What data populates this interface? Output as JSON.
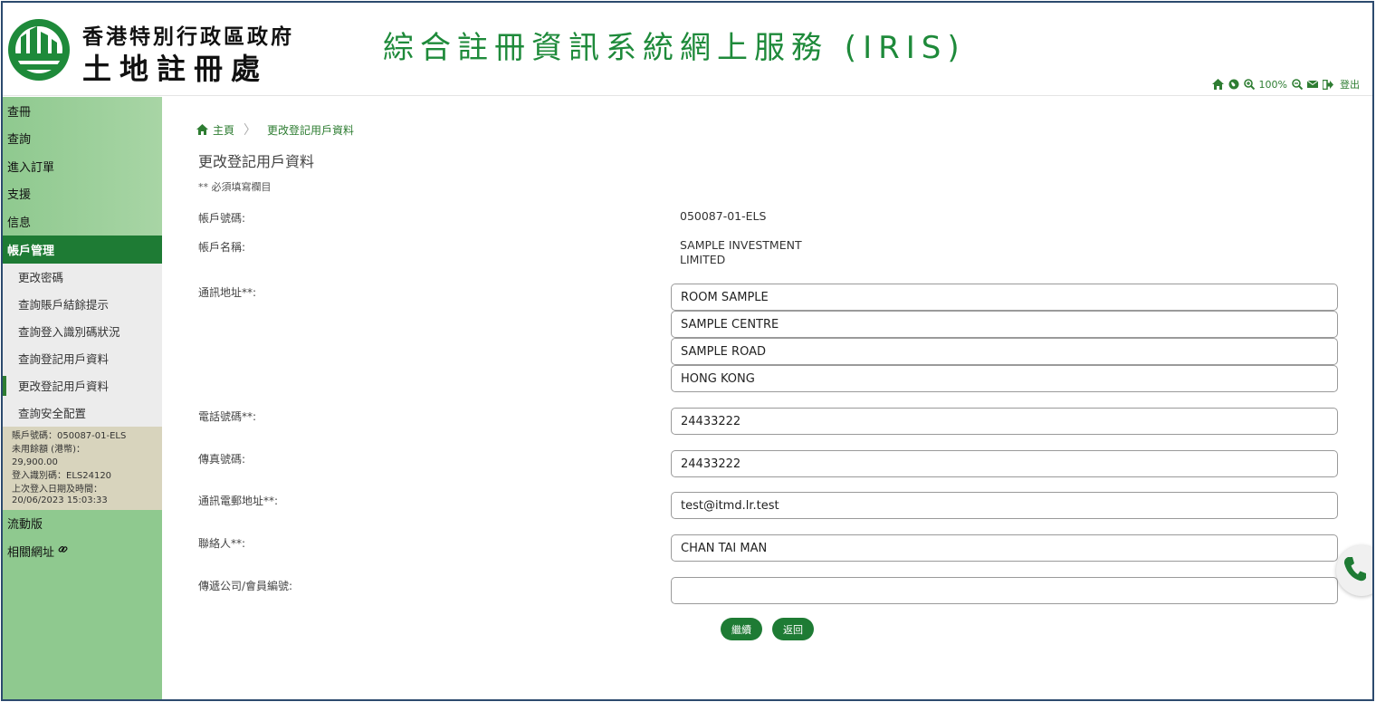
{
  "header": {
    "org_line1": "香港特別行政區政府",
    "org_line2": "土地註冊處",
    "system_title": "綜合註冊資訊系統網上服務 (IRIS)"
  },
  "toolbar": {
    "zoom_level": "100%",
    "logout_label": "登出",
    "icons": [
      "home-icon",
      "globe-icon",
      "zoom-in-icon",
      "zoom-out-icon",
      "mail-icon",
      "logout-icon"
    ]
  },
  "sidebar": {
    "items_top": [
      {
        "label": "查冊"
      },
      {
        "label": "查詢"
      },
      {
        "label": "進入訂單"
      },
      {
        "label": "支援"
      },
      {
        "label": "信息"
      },
      {
        "label": "帳戶管理"
      }
    ],
    "sub_items": [
      {
        "label": "更改密碼"
      },
      {
        "label": "查詢賬戶結餘提示"
      },
      {
        "label": "查詢登入識別碼狀況"
      },
      {
        "label": "查詢登記用戶資料"
      },
      {
        "label": "更改登記用戶資料"
      },
      {
        "label": "查詢安全配置"
      }
    ],
    "info": {
      "account_no": "賬戶號碼：050087-01-ELS",
      "balance_label": "未用餘額 (港幣)：",
      "balance_value": "29,900.00",
      "login_id": "登入識別碼：ELS24120",
      "last_login_label": "上次登入日期及時間：",
      "last_login_value": "20/06/2023 15:03:33"
    },
    "items_bottom": [
      {
        "label": "流動版"
      },
      {
        "label": "相關網址"
      }
    ]
  },
  "breadcrumb": {
    "home": "主頁",
    "current": "更改登記用戶資料"
  },
  "form": {
    "title": "更改登記用戶資料",
    "required_note": "** 必須填寫欄目",
    "account_no_label": "帳戶號碼:",
    "account_no_value": "050087-01-ELS",
    "account_name_label": "帳戶名稱:",
    "account_name_line1": "SAMPLE INVESTMENT",
    "account_name_line2": "LIMITED",
    "address_label": "通訊地址**:",
    "address_lines": [
      "ROOM SAMPLE",
      "SAMPLE CENTRE",
      "SAMPLE ROAD",
      "HONG KONG"
    ],
    "phone_label": "電話號碼**:",
    "phone_value": "24433222",
    "fax_label": "傳真號碼:",
    "fax_value": "24433222",
    "email_label": "通訊電郵地址**:",
    "email_value": "test@itmd.lr.test",
    "contact_label": "聯絡人**:",
    "contact_value": "CHAN TAI MAN",
    "company_label": "傳遞公司/會員編號:",
    "company_value": ""
  },
  "buttons": {
    "continue_label": "繼續",
    "back_label": "返回"
  },
  "colors": {
    "brand_green": "#1e7b34",
    "title_green": "#1e8a3a",
    "sidebar_green": "#8fc98f"
  }
}
